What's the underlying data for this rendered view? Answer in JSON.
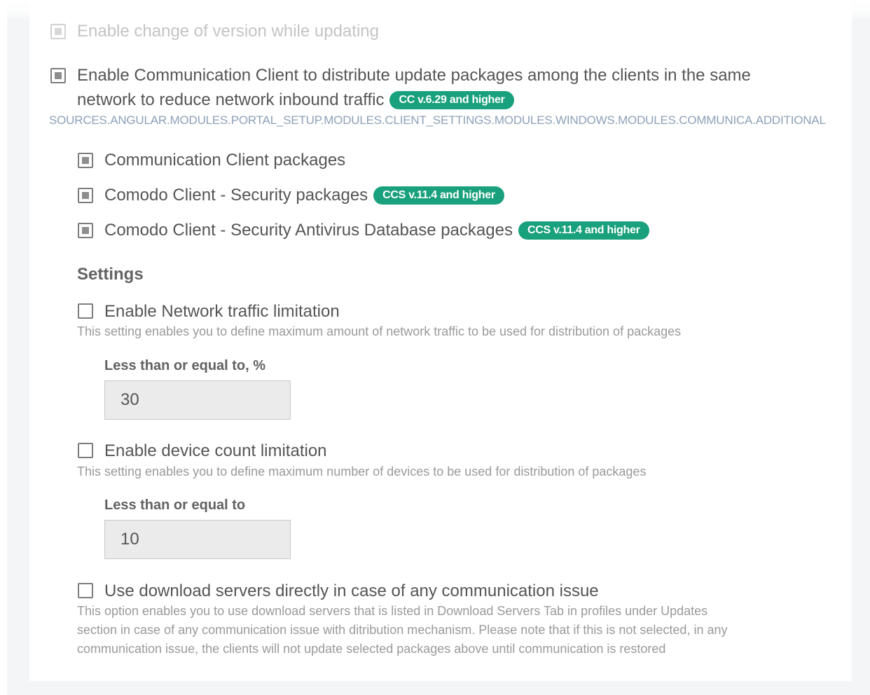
{
  "faded_option": {
    "label": "Enable change of version while updating",
    "checked": true
  },
  "comm_client": {
    "label_line1": "Enable Communication Client to distribute update packages among the clients in the same",
    "label_line2": "network to reduce network inbound traffic",
    "badge": "CC v.6.29 and higher",
    "checked": true,
    "i18n_key": "SOURCES.ANGULAR.MODULES.PORTAL_SETUP.MODULES.CLIENT_SETTINGS.MODULES.WINDOWS.MODULES.COMMUNICA.ADDITIONAL"
  },
  "packages": [
    {
      "label": "Communication Client packages",
      "checked": true,
      "badge": ""
    },
    {
      "label": "Comodo Client - Security packages",
      "checked": true,
      "badge": "CCS v.11.4 and higher"
    },
    {
      "label": "Comodo Client - Security Antivirus Database packages",
      "checked": true,
      "badge": "CCS v.11.4 and higher"
    }
  ],
  "settings": {
    "title": "Settings",
    "network_limit": {
      "label": "Enable Network traffic limitation",
      "checked": false,
      "description": "This setting enables you to define maximum amount of network traffic to be used for distribution of packages",
      "field_label": "Less than or equal to, %",
      "value": "30"
    },
    "device_limit": {
      "label": "Enable device count limitation",
      "checked": false,
      "description": "This setting enables you to define maximum number of devices to be used for distribution of packages",
      "field_label": "Less than or equal to",
      "value": "10"
    },
    "download_servers": {
      "label": "Use download servers directly in case of any communication issue",
      "checked": false,
      "description_lines": [
        "This option enables you to use download servers that is listed in Download Servers Tab in profiles under Updates",
        "section in case of any communication issue with ditribution mechanism. Please note that if this is not selected, in any",
        "communication issue, the clients will not update selected packages above until communication is restored"
      ]
    }
  },
  "colors": {
    "badge_green": "#19a07c",
    "key_text_blue": "#8ea0b8",
    "panel_bg": "#ffffff",
    "frame_bg": "#f3f5f7"
  }
}
